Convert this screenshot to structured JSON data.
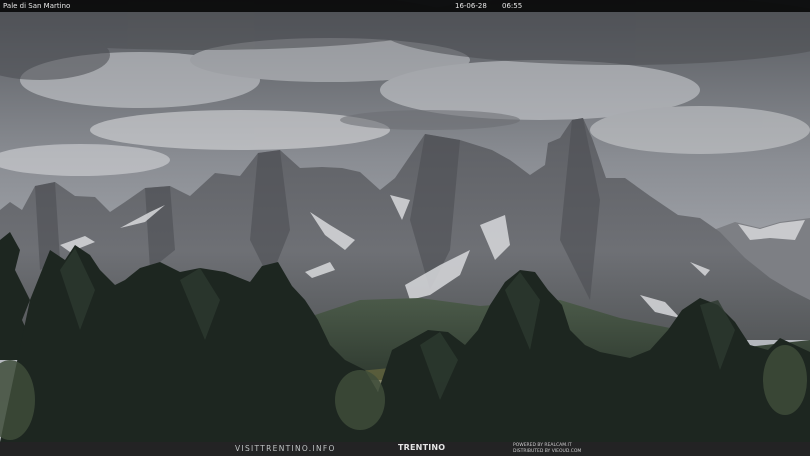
{
  "overlay": {
    "location": "Pale di San Martino",
    "date": "16-06-28",
    "time": "06:55"
  },
  "footer": {
    "website": "VISITTRENTINO.INFO",
    "brand": "TRENTINO",
    "credit_line1": "POWERED BY REALCAM.IT",
    "credit_line2": "DISTRIBUTED BY VIEOUD.COM"
  },
  "colors": {
    "sky_top": "#5e6065",
    "sky_bottom": "#b9bcc2",
    "rock": "#6c6e73",
    "forest": "#1f2a24",
    "meadow": "#4f5f45"
  }
}
